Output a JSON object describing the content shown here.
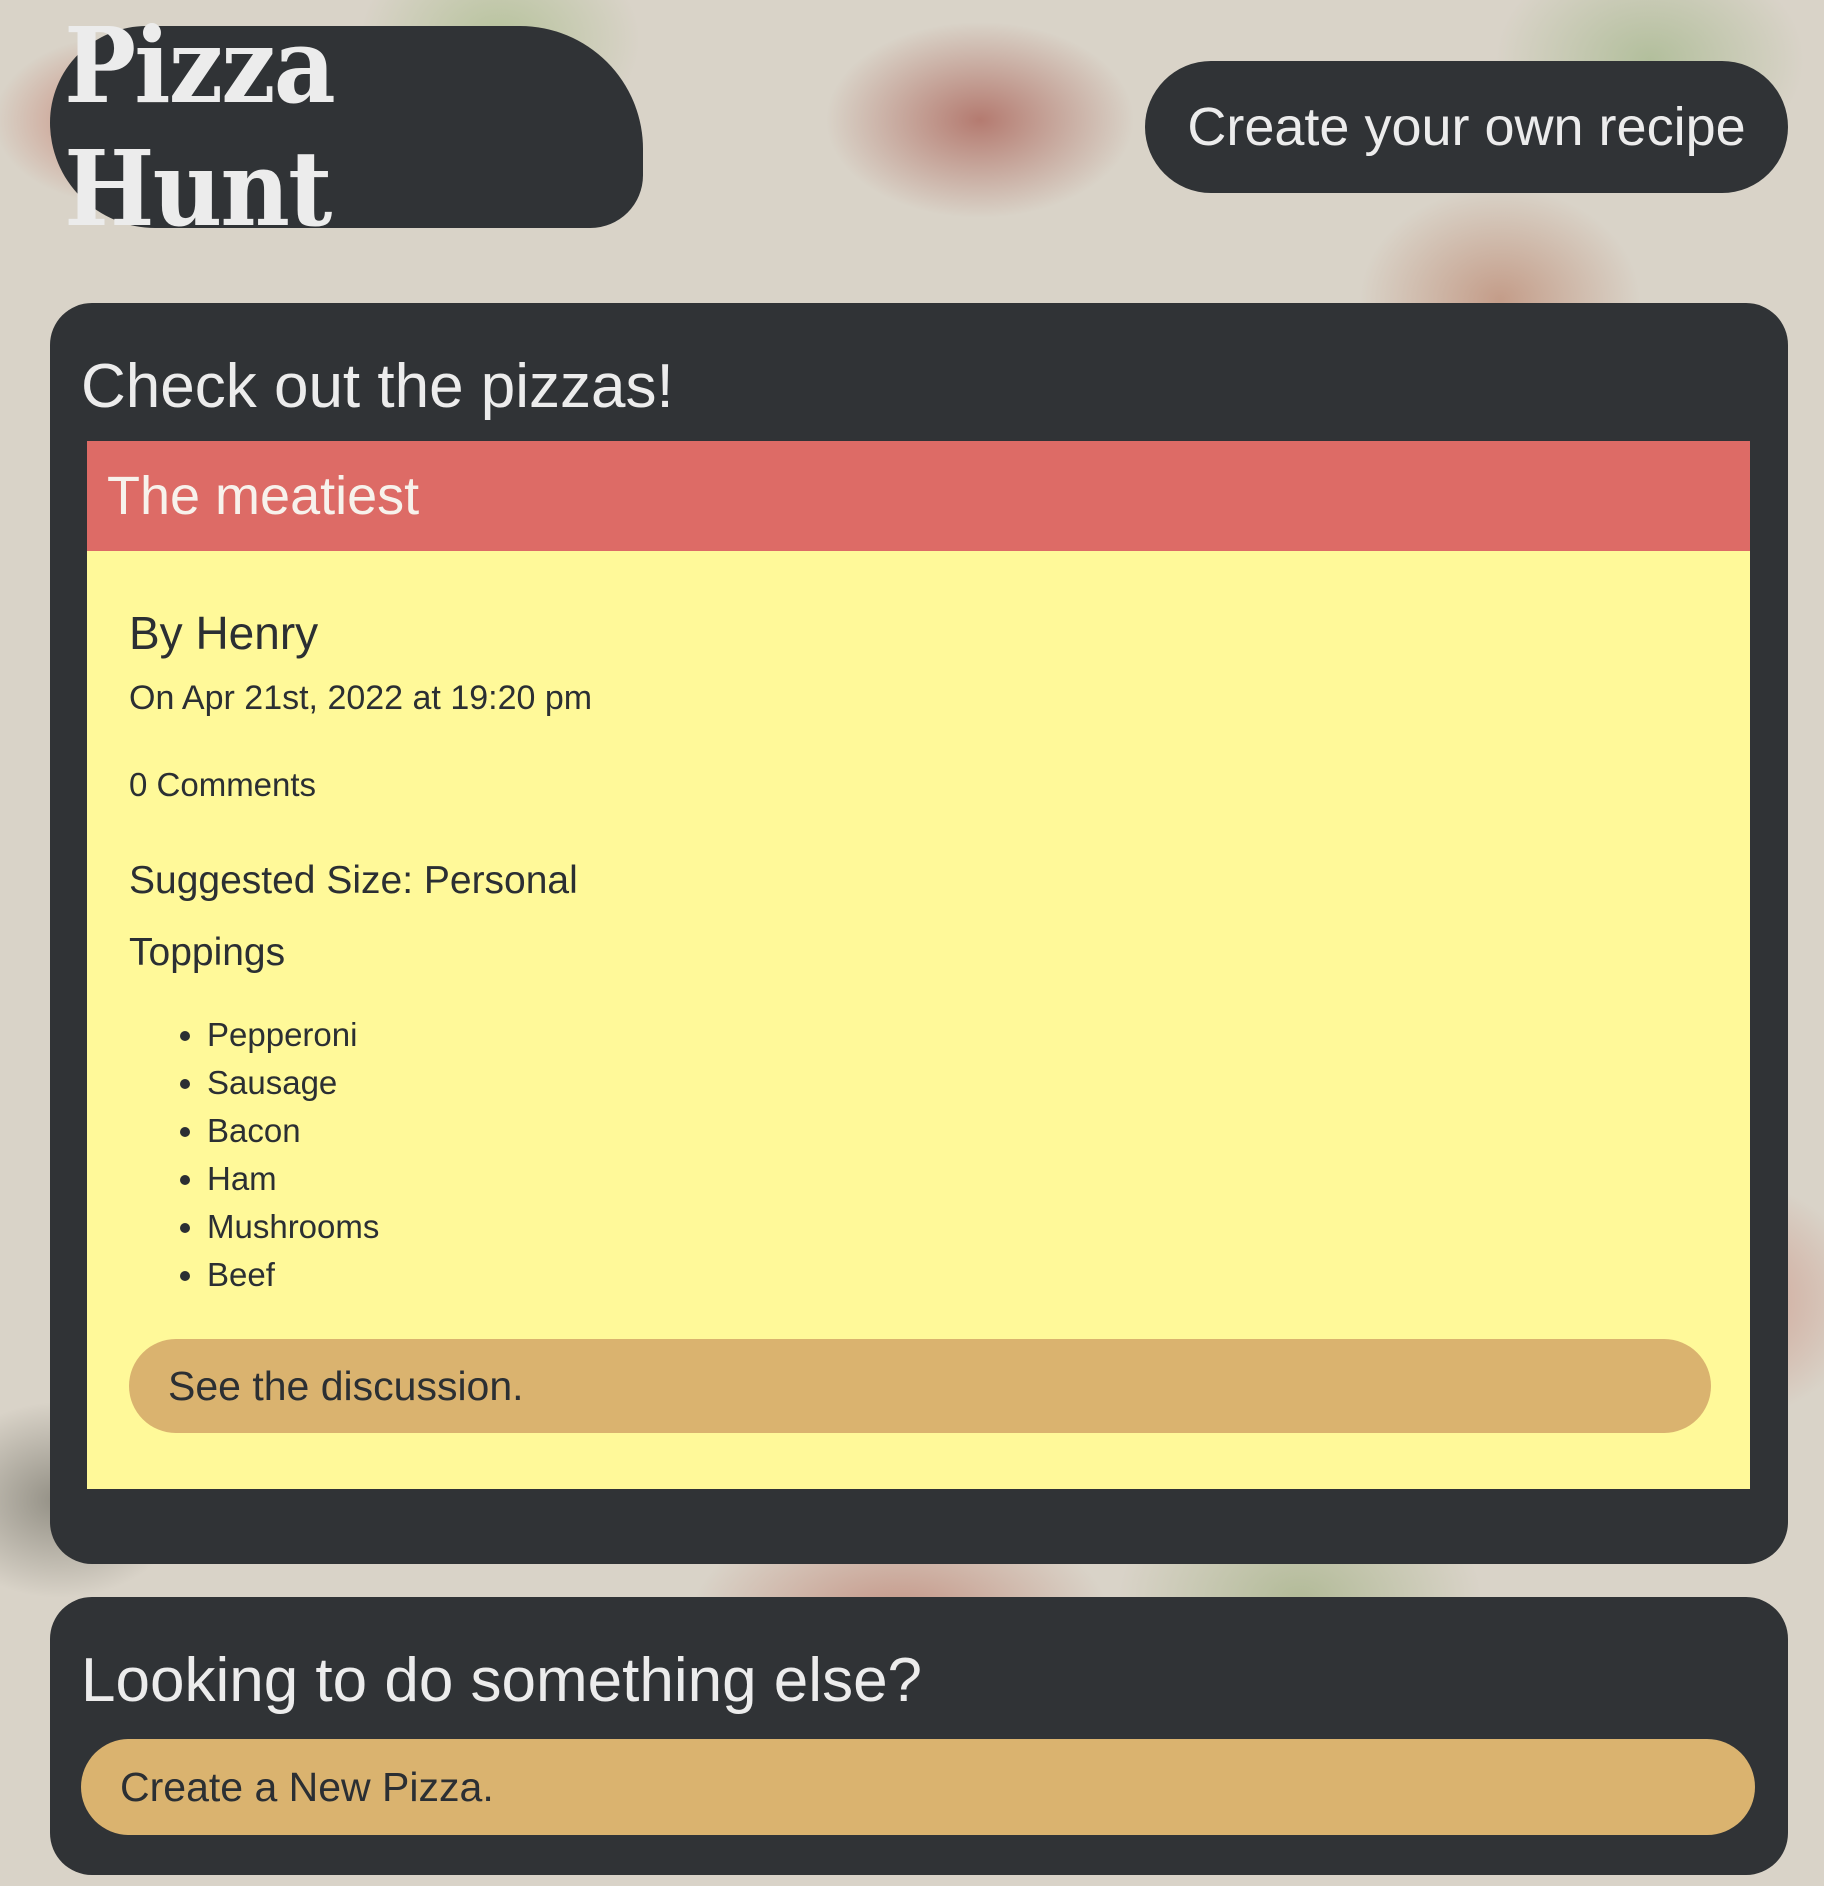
{
  "header": {
    "logo_text": "Pizza Hunt",
    "nav_link": "Create your own recipe"
  },
  "main": {
    "title": "Check out the pizzas!",
    "pizzas": [
      {
        "name": "The meatiest",
        "author": "By Henry",
        "date": "On Apr 21st, 2022 at 19:20 pm",
        "comments": "0 Comments",
        "size": "Suggested Size: Personal",
        "toppings_label": "Toppings",
        "toppings": [
          "Pepperoni",
          "Sausage",
          "Bacon",
          "Ham",
          "Mushrooms",
          "Beef"
        ],
        "discussion_button": "See the discussion."
      }
    ]
  },
  "other": {
    "title": "Looking to do something else?",
    "create_button": "Create a New Pizza."
  },
  "colors": {
    "panel": "#303336",
    "card_header": "#dd6b66",
    "card_body": "#fff999",
    "button": "#dab36f"
  }
}
